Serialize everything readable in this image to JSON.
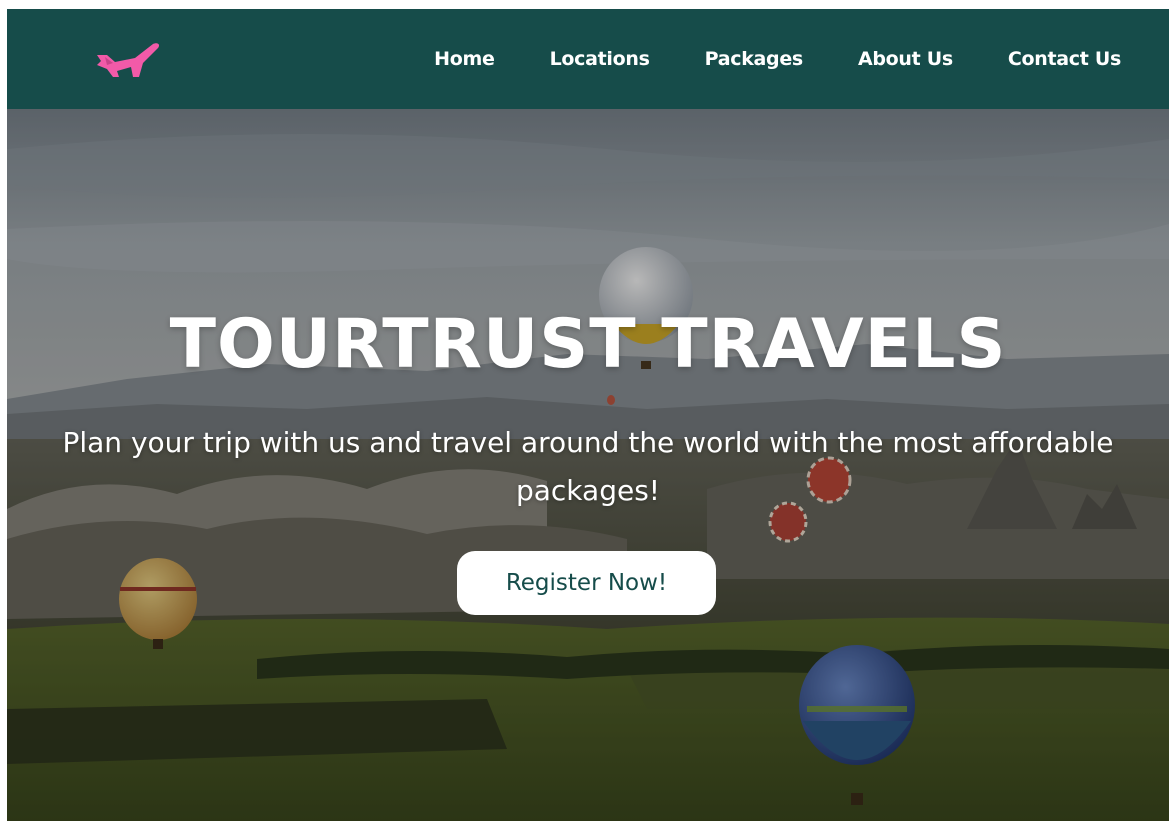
{
  "navbar": {
    "logo_icon": "airplane-icon",
    "background": "#164c4a",
    "logo_color": "#f25aa8",
    "links": [
      {
        "label": "Home"
      },
      {
        "label": "Locations"
      },
      {
        "label": "Packages"
      },
      {
        "label": "About Us"
      },
      {
        "label": "Contact Us"
      }
    ]
  },
  "hero": {
    "title": "TOURTRUST TRAVELS",
    "subtitle": "Plan your trip with us and travel around the world with the most affordable packages!",
    "cta_label": "Register Now!",
    "cta_text_color": "#164c4a"
  }
}
